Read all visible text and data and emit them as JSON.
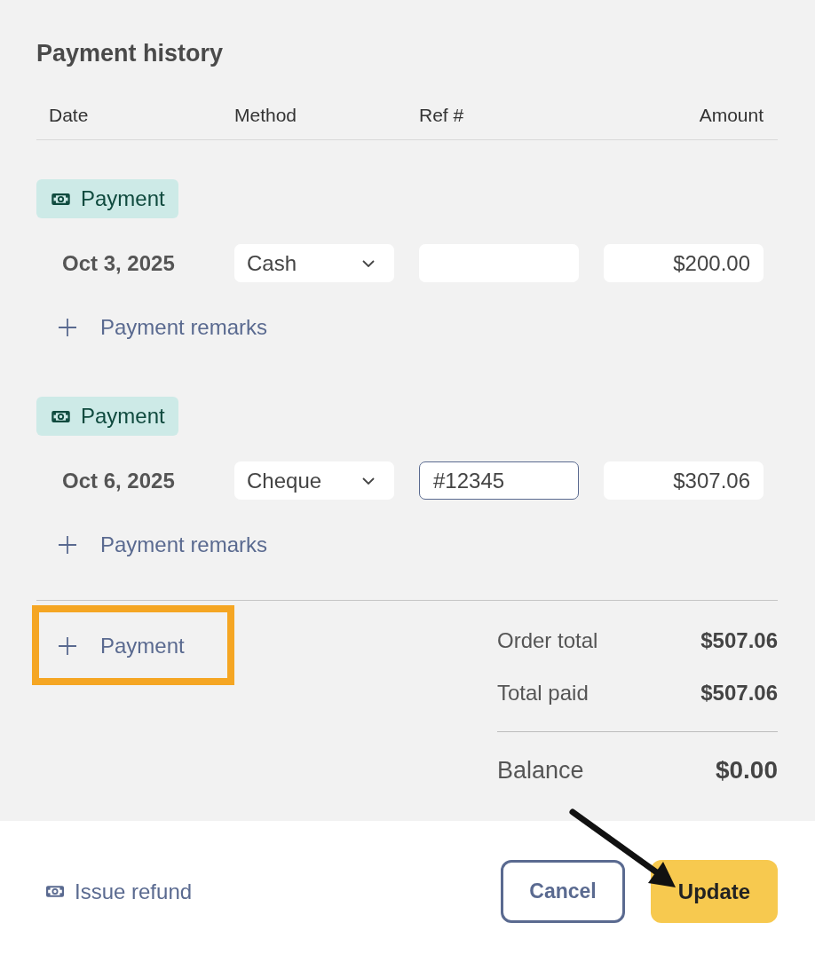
{
  "title": "Payment history",
  "columns": [
    "Date",
    "Method",
    "Ref #",
    "Amount"
  ],
  "payments": [
    {
      "tag": "Payment",
      "date": "Oct 3, 2025",
      "method": "Cash",
      "ref_field": {
        "focused": false
      },
      "amount": "$200.00",
      "remarks_link": "Payment remarks"
    },
    {
      "tag": "Payment",
      "date": "Oct 6, 2025",
      "method": "Cheque",
      "ref_field": {
        "value": "#12345",
        "focused": true
      },
      "amount": "$307.06",
      "remarks_link": "Payment remarks"
    }
  ],
  "add_payment": {
    "label": "Payment",
    "highlighted": true
  },
  "summary": [
    {
      "kind": "line",
      "label": "Order total",
      "value": "$507.06"
    },
    {
      "kind": "line",
      "label": "Total paid",
      "value": "$507.06"
    },
    {
      "kind": "balance",
      "label": "Balance",
      "value": "$0.00"
    }
  ],
  "footer": {
    "refund_link": "Issue refund",
    "buttons": [
      {
        "kind": "outline",
        "label": "Cancel"
      },
      {
        "kind": "filled",
        "label": "Update"
      }
    ]
  },
  "pointer_arrow": true
}
